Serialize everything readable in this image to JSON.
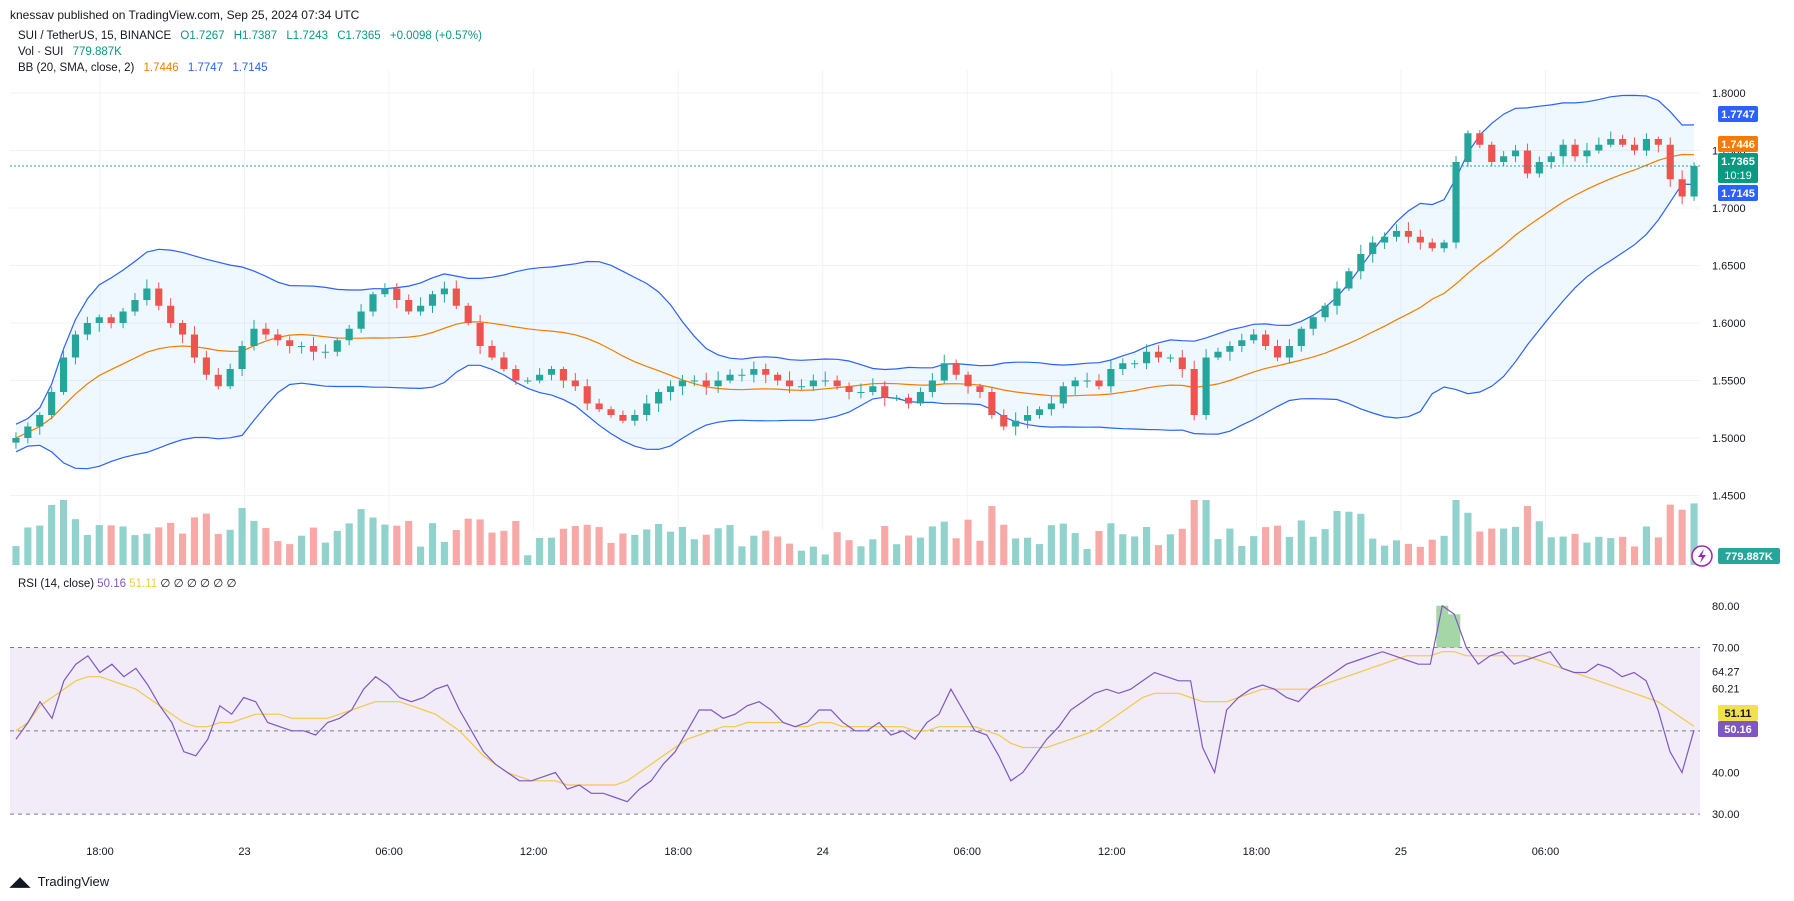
{
  "header": {
    "published": "knessav published on TradingView.com, Sep 25, 2024 07:34 UTC"
  },
  "legend": {
    "symbol": "SUI / TetherUS, 15, BINANCE",
    "open": "O1.7267",
    "high": "H1.7387",
    "low": "L1.7243",
    "close": "C1.7365",
    "change": "+0.0098 (+0.57%)",
    "vol_label": "Vol · SUI",
    "vol_value": "779.887K",
    "bb_label": "BB (20, SMA, close, 2)",
    "bb_basis": "1.7446",
    "bb_upper": "1.7747",
    "bb_lower": "1.7145",
    "rsi_label": "RSI (14, close)",
    "rsi_value": "50.16",
    "rsi_ma": "51.11",
    "rsi_extra": "∅ ∅ ∅ ∅ ∅ ∅"
  },
  "price_badges": {
    "upper": "1.7747",
    "basis": "1.7446",
    "last": "1.7365",
    "countdown": "10:19",
    "lower": "1.7145",
    "volume": "779.887K"
  },
  "rsi_badges": {
    "ma": "51.11",
    "rsi": "50.16"
  },
  "footer": {
    "brand": "TradingView"
  },
  "colors": {
    "up": "#26a69a",
    "down": "#ef5350",
    "basis": "#f57c00",
    "band": "#2962ff",
    "rsi": "#7e57c2",
    "rsi_ma": "#f2c94c",
    "rsi_bg": "#ede7f6"
  },
  "chart_data": [
    {
      "type": "candlestick",
      "title": "SUI / TetherUS, 15, BINANCE",
      "ylim": [
        1.42,
        1.82
      ],
      "y_ticks": [
        1.45,
        1.5,
        1.55,
        1.6,
        1.65,
        1.7,
        1.75,
        1.8
      ],
      "x_ticks": [
        "18:00",
        "23",
        "06:00",
        "12:00",
        "18:00",
        "24",
        "06:00",
        "12:00",
        "18:00",
        "25",
        "06:00"
      ],
      "price_path": [
        1.5,
        1.51,
        1.52,
        1.54,
        1.57,
        1.59,
        1.6,
        1.605,
        1.6,
        1.61,
        1.62,
        1.63,
        1.615,
        1.6,
        1.59,
        1.57,
        1.555,
        1.545,
        1.56,
        1.58,
        1.595,
        1.59,
        1.585,
        1.58,
        1.58,
        1.575,
        1.575,
        1.585,
        1.595,
        1.61,
        1.625,
        1.63,
        1.62,
        1.61,
        1.615,
        1.625,
        1.63,
        1.615,
        1.6,
        1.58,
        1.57,
        1.56,
        1.55,
        1.55,
        1.555,
        1.56,
        1.55,
        1.545,
        1.53,
        1.525,
        1.52,
        1.515,
        1.52,
        1.53,
        1.54,
        1.545,
        1.55,
        1.55,
        1.545,
        1.55,
        1.555,
        1.555,
        1.56,
        1.555,
        1.55,
        1.545,
        1.545,
        1.55,
        1.55,
        1.545,
        1.54,
        1.54,
        1.545,
        1.535,
        1.535,
        1.53,
        1.54,
        1.55,
        1.565,
        1.555,
        1.545,
        1.54,
        1.52,
        1.51,
        1.515,
        1.52,
        1.525,
        1.53,
        1.545,
        1.55,
        1.55,
        1.545,
        1.56,
        1.565,
        1.565,
        1.575,
        1.57,
        1.57,
        1.56,
        1.52,
        1.57,
        1.575,
        1.58,
        1.585,
        1.59,
        1.58,
        1.57,
        1.58,
        1.595,
        1.605,
        1.615,
        1.63,
        1.645,
        1.66,
        1.67,
        1.675,
        1.68,
        1.675,
        1.67,
        1.665,
        1.67,
        1.74,
        1.765,
        1.755,
        1.74,
        1.745,
        1.75,
        1.73,
        1.74,
        1.745,
        1.755,
        1.745,
        1.75,
        1.755,
        1.76,
        1.755,
        1.75,
        1.76,
        1.755,
        1.725,
        1.71,
        1.7365
      ],
      "volume_range": [
        0,
        1000000
      ],
      "last_volume": 779887
    },
    {
      "type": "line",
      "title": "RSI (14, close)",
      "ylim": [
        25,
        85
      ],
      "y_ticks": [
        30,
        40,
        64.27,
        60.21,
        70,
        80
      ],
      "series": [
        {
          "name": "RSI",
          "values": [
            48,
            52,
            57,
            53,
            62,
            66,
            68,
            64,
            66,
            63,
            65,
            61,
            56,
            52,
            45,
            44,
            48,
            56,
            54,
            58,
            57,
            52,
            51,
            50,
            50,
            49,
            52,
            53,
            55,
            60,
            63,
            61,
            58,
            57,
            58,
            60,
            61,
            55,
            50,
            45,
            42,
            40,
            38,
            38,
            39,
            40,
            36,
            37,
            35,
            35,
            34,
            33,
            36,
            38,
            42,
            45,
            50,
            55,
            55,
            53,
            54,
            56,
            57,
            55,
            52,
            51,
            52,
            55,
            55,
            52,
            50,
            50,
            52,
            49,
            50,
            48,
            52,
            54,
            60,
            55,
            50,
            49,
            44,
            38,
            40,
            44,
            48,
            51,
            55,
            57,
            59,
            60,
            59,
            60,
            62,
            64,
            63,
            62,
            62,
            46,
            40,
            55,
            58,
            60,
            61,
            60,
            58,
            57,
            60,
            62,
            64,
            66,
            67,
            68,
            69,
            68,
            67,
            66,
            66,
            80,
            78,
            70,
            66,
            68,
            69,
            66,
            67,
            68,
            69,
            65,
            64,
            64,
            66,
            65,
            63,
            64,
            62,
            55,
            45,
            40,
            50.16
          ]
        },
        {
          "name": "RSI MA",
          "values": [
            50,
            52,
            56,
            58,
            60,
            62,
            63,
            63,
            62,
            61,
            60,
            58,
            56,
            54,
            52,
            51,
            51,
            52,
            52,
            53,
            54,
            54,
            54,
            53,
            53,
            53,
            53,
            54,
            55,
            56,
            57,
            57,
            57,
            56,
            55,
            54,
            52,
            50,
            47,
            44,
            42,
            40,
            39,
            38,
            38,
            38,
            37,
            37,
            37,
            37,
            37,
            38,
            40,
            42,
            44,
            46,
            48,
            49,
            50,
            51,
            51,
            52,
            52,
            52,
            52,
            51,
            51,
            52,
            52,
            51,
            51,
            51,
            51,
            51,
            51,
            50,
            50,
            51,
            51,
            51,
            51,
            50,
            49,
            47,
            46,
            46,
            46,
            47,
            48,
            49,
            50,
            52,
            54,
            56,
            58,
            59,
            59,
            59,
            58,
            57,
            57,
            57,
            58,
            59,
            60,
            60,
            60,
            60,
            60,
            61,
            62,
            63,
            64,
            65,
            66,
            67,
            68,
            68,
            68,
            69,
            69,
            68,
            68,
            68,
            68,
            68,
            68,
            67,
            66,
            65,
            64,
            63,
            62,
            61,
            60,
            59,
            58,
            57,
            55,
            53,
            51.11
          ]
        }
      ]
    }
  ]
}
